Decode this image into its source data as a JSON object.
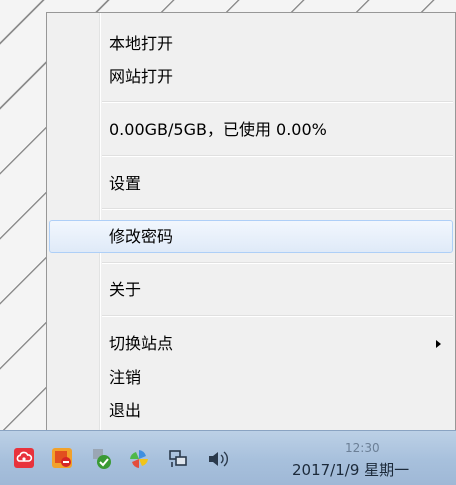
{
  "menu": {
    "items": [
      {
        "label": "本地打开"
      },
      {
        "label": "网站打开"
      },
      {
        "label": "0.00GB/5GB，已使用 0.00%"
      },
      {
        "label": "设置"
      },
      {
        "label": "修改密码"
      },
      {
        "label": "关于"
      },
      {
        "label": "切换站点"
      },
      {
        "label": "注销"
      },
      {
        "label": "退出"
      }
    ]
  },
  "taskbar": {
    "clock_partial": "12:30",
    "date": "2017/1/9 星期一",
    "tray_icons": [
      "cloud-app-icon",
      "security-alert-icon",
      "shield-check-icon",
      "pinwheel-icon",
      "network-icon",
      "speaker-icon"
    ]
  }
}
